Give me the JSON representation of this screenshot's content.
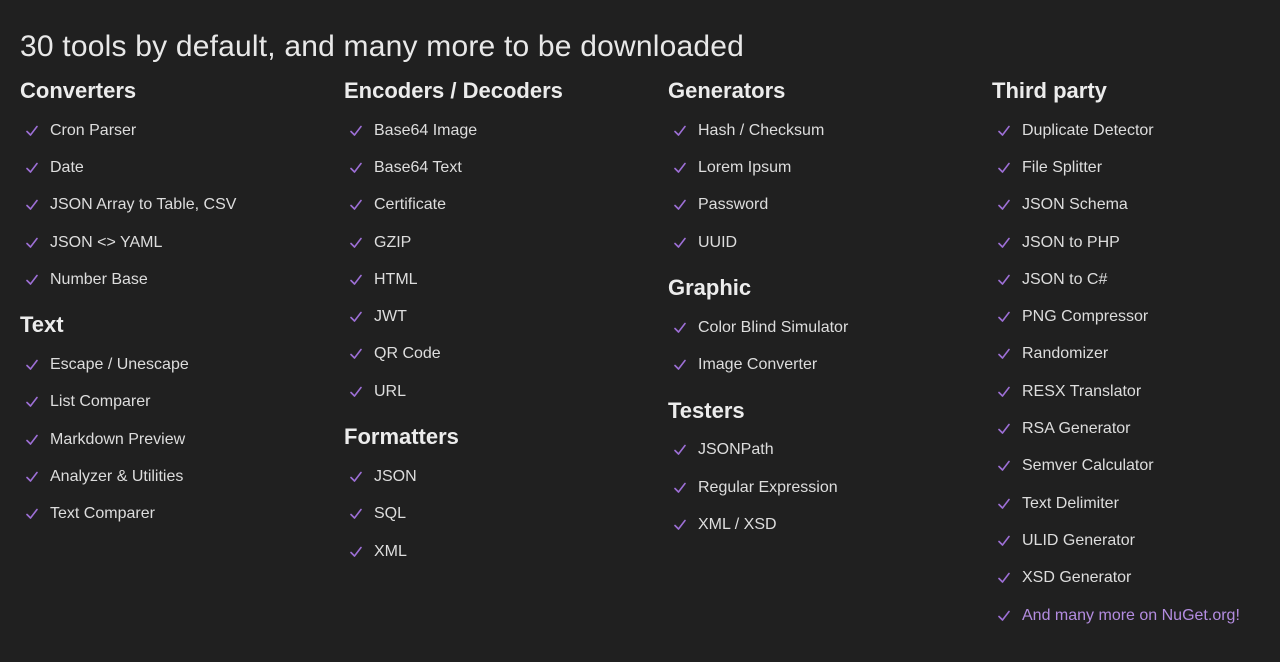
{
  "headline": "30 tools by default, and many more to be downloaded",
  "accent_color": "#9d6fd6",
  "check_icon": "checkmark-icon",
  "columns": [
    {
      "sections": [
        {
          "title": "Converters",
          "items": [
            "Cron Parser",
            "Date",
            "JSON Array to Table, CSV",
            "JSON <> YAML",
            "Number Base"
          ]
        },
        {
          "title": "Text",
          "items": [
            "Escape / Unescape",
            "List Comparer",
            "Markdown Preview",
            "Analyzer & Utilities",
            "Text Comparer"
          ]
        }
      ]
    },
    {
      "sections": [
        {
          "title": "Encoders / Decoders",
          "items": [
            "Base64 Image",
            "Base64 Text",
            "Certificate",
            "GZIP",
            "HTML",
            "JWT",
            "QR Code",
            "URL"
          ]
        },
        {
          "title": "Formatters",
          "items": [
            "JSON",
            "SQL",
            "XML"
          ]
        }
      ]
    },
    {
      "sections": [
        {
          "title": "Generators",
          "items": [
            "Hash / Checksum",
            "Lorem Ipsum",
            "Password",
            "UUID"
          ]
        },
        {
          "title": "Graphic",
          "items": [
            "Color Blind Simulator",
            "Image Converter"
          ]
        },
        {
          "title": "Testers",
          "items": [
            "JSONPath",
            "Regular Expression",
            "XML / XSD"
          ]
        }
      ]
    },
    {
      "sections": [
        {
          "title": "Third party",
          "items": [
            "Duplicate Detector",
            "File Splitter",
            "JSON Schema",
            "JSON to PHP",
            "JSON to C#",
            "PNG Compressor",
            "Randomizer",
            "RESX Translator",
            "RSA Generator",
            "Semver Calculator",
            "Text Delimiter",
            "ULID Generator",
            "XSD Generator"
          ],
          "link_item": "And many more on NuGet.org!"
        }
      ]
    }
  ]
}
